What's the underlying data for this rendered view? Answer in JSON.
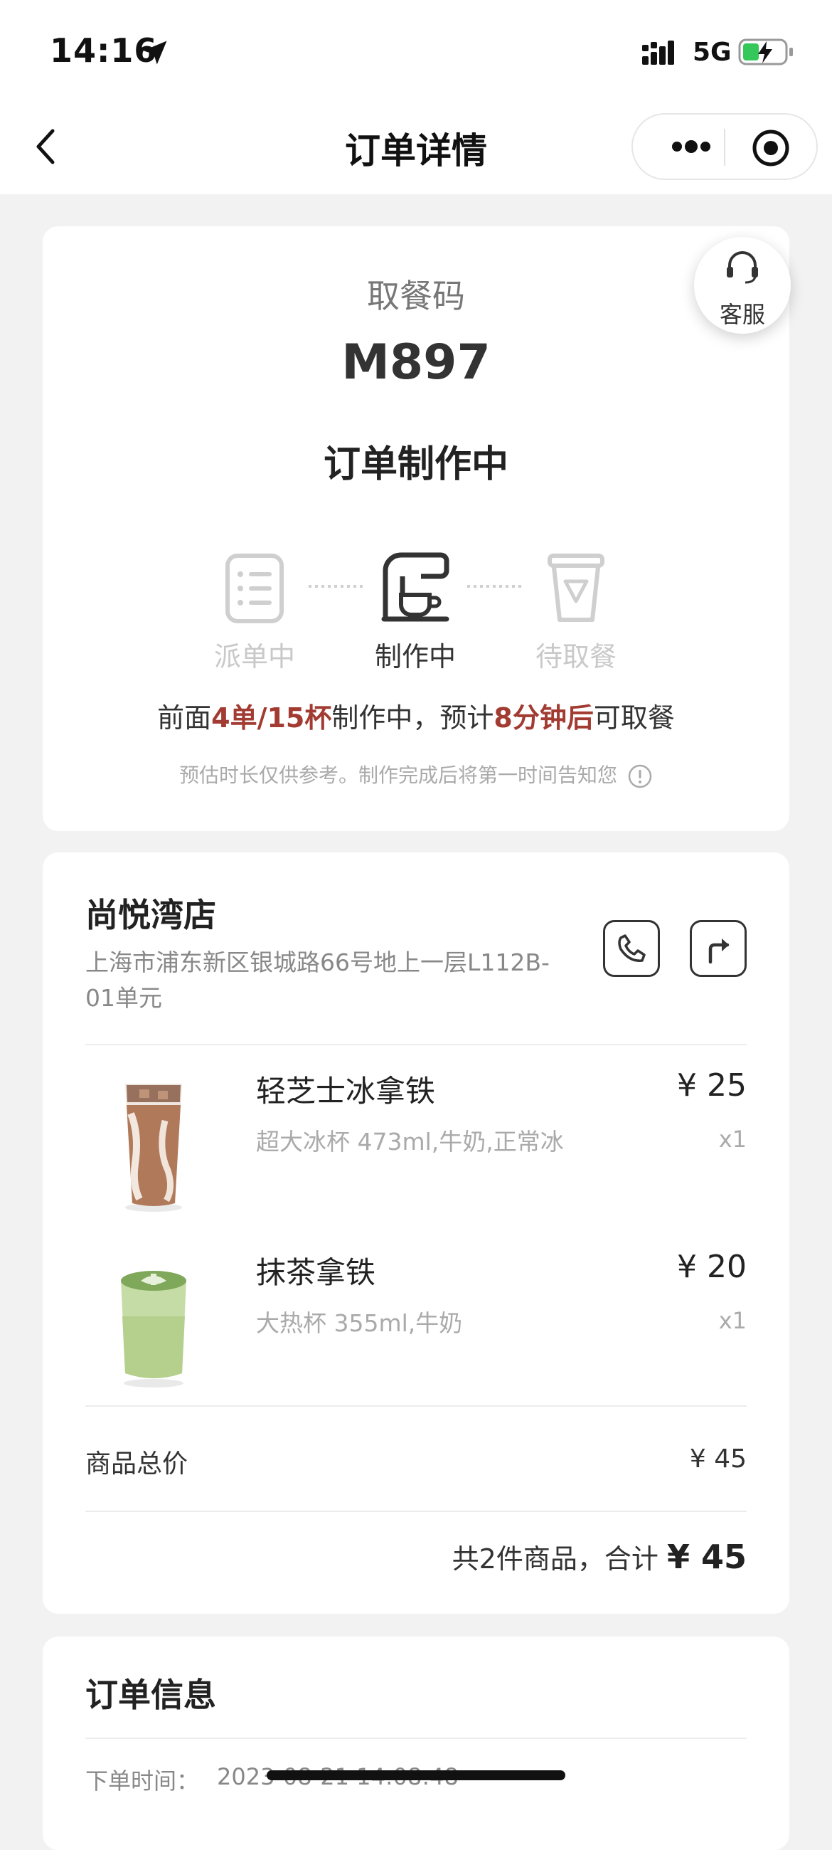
{
  "status_bar": {
    "time": "14:16",
    "network": "5G"
  },
  "nav": {
    "title": "订单详情"
  },
  "customer_service": {
    "label": "客服"
  },
  "pickup": {
    "code_label": "取餐码",
    "code": "M897",
    "status": "订单制作中",
    "steps": [
      {
        "label": "派单中",
        "state": "done"
      },
      {
        "label": "制作中",
        "state": "active"
      },
      {
        "label": "待取餐",
        "state": "pending"
      }
    ],
    "queue": {
      "prefix": "前面",
      "count_text": "4单/15杯",
      "middle": "制作中，预计",
      "eta_text": "8分钟后",
      "suffix": "可取餐"
    },
    "note": "预估时长仅供参考。制作完成后将第一时间告知您"
  },
  "store": {
    "name": "尚悦湾店",
    "address": "上海市浦东新区银城路66号地上一层L112B-01单元"
  },
  "items": [
    {
      "name": "轻芝士冰拿铁",
      "spec": "超大冰杯 473ml,牛奶,正常冰",
      "price": "¥ 25",
      "qty": "x1"
    },
    {
      "name": "抹茶拿铁",
      "spec": "大热杯 355ml,牛奶",
      "price": "¥ 20",
      "qty": "x1"
    }
  ],
  "totals": {
    "subtotal_label": "商品总价",
    "subtotal_value": "¥ 45",
    "summary_prefix": "共2件商品，合计",
    "summary_total": "¥ 45"
  },
  "order_info": {
    "title": "订单信息",
    "time_label": "下单时间：",
    "time_value": "2023-08-21 14:08:48"
  }
}
